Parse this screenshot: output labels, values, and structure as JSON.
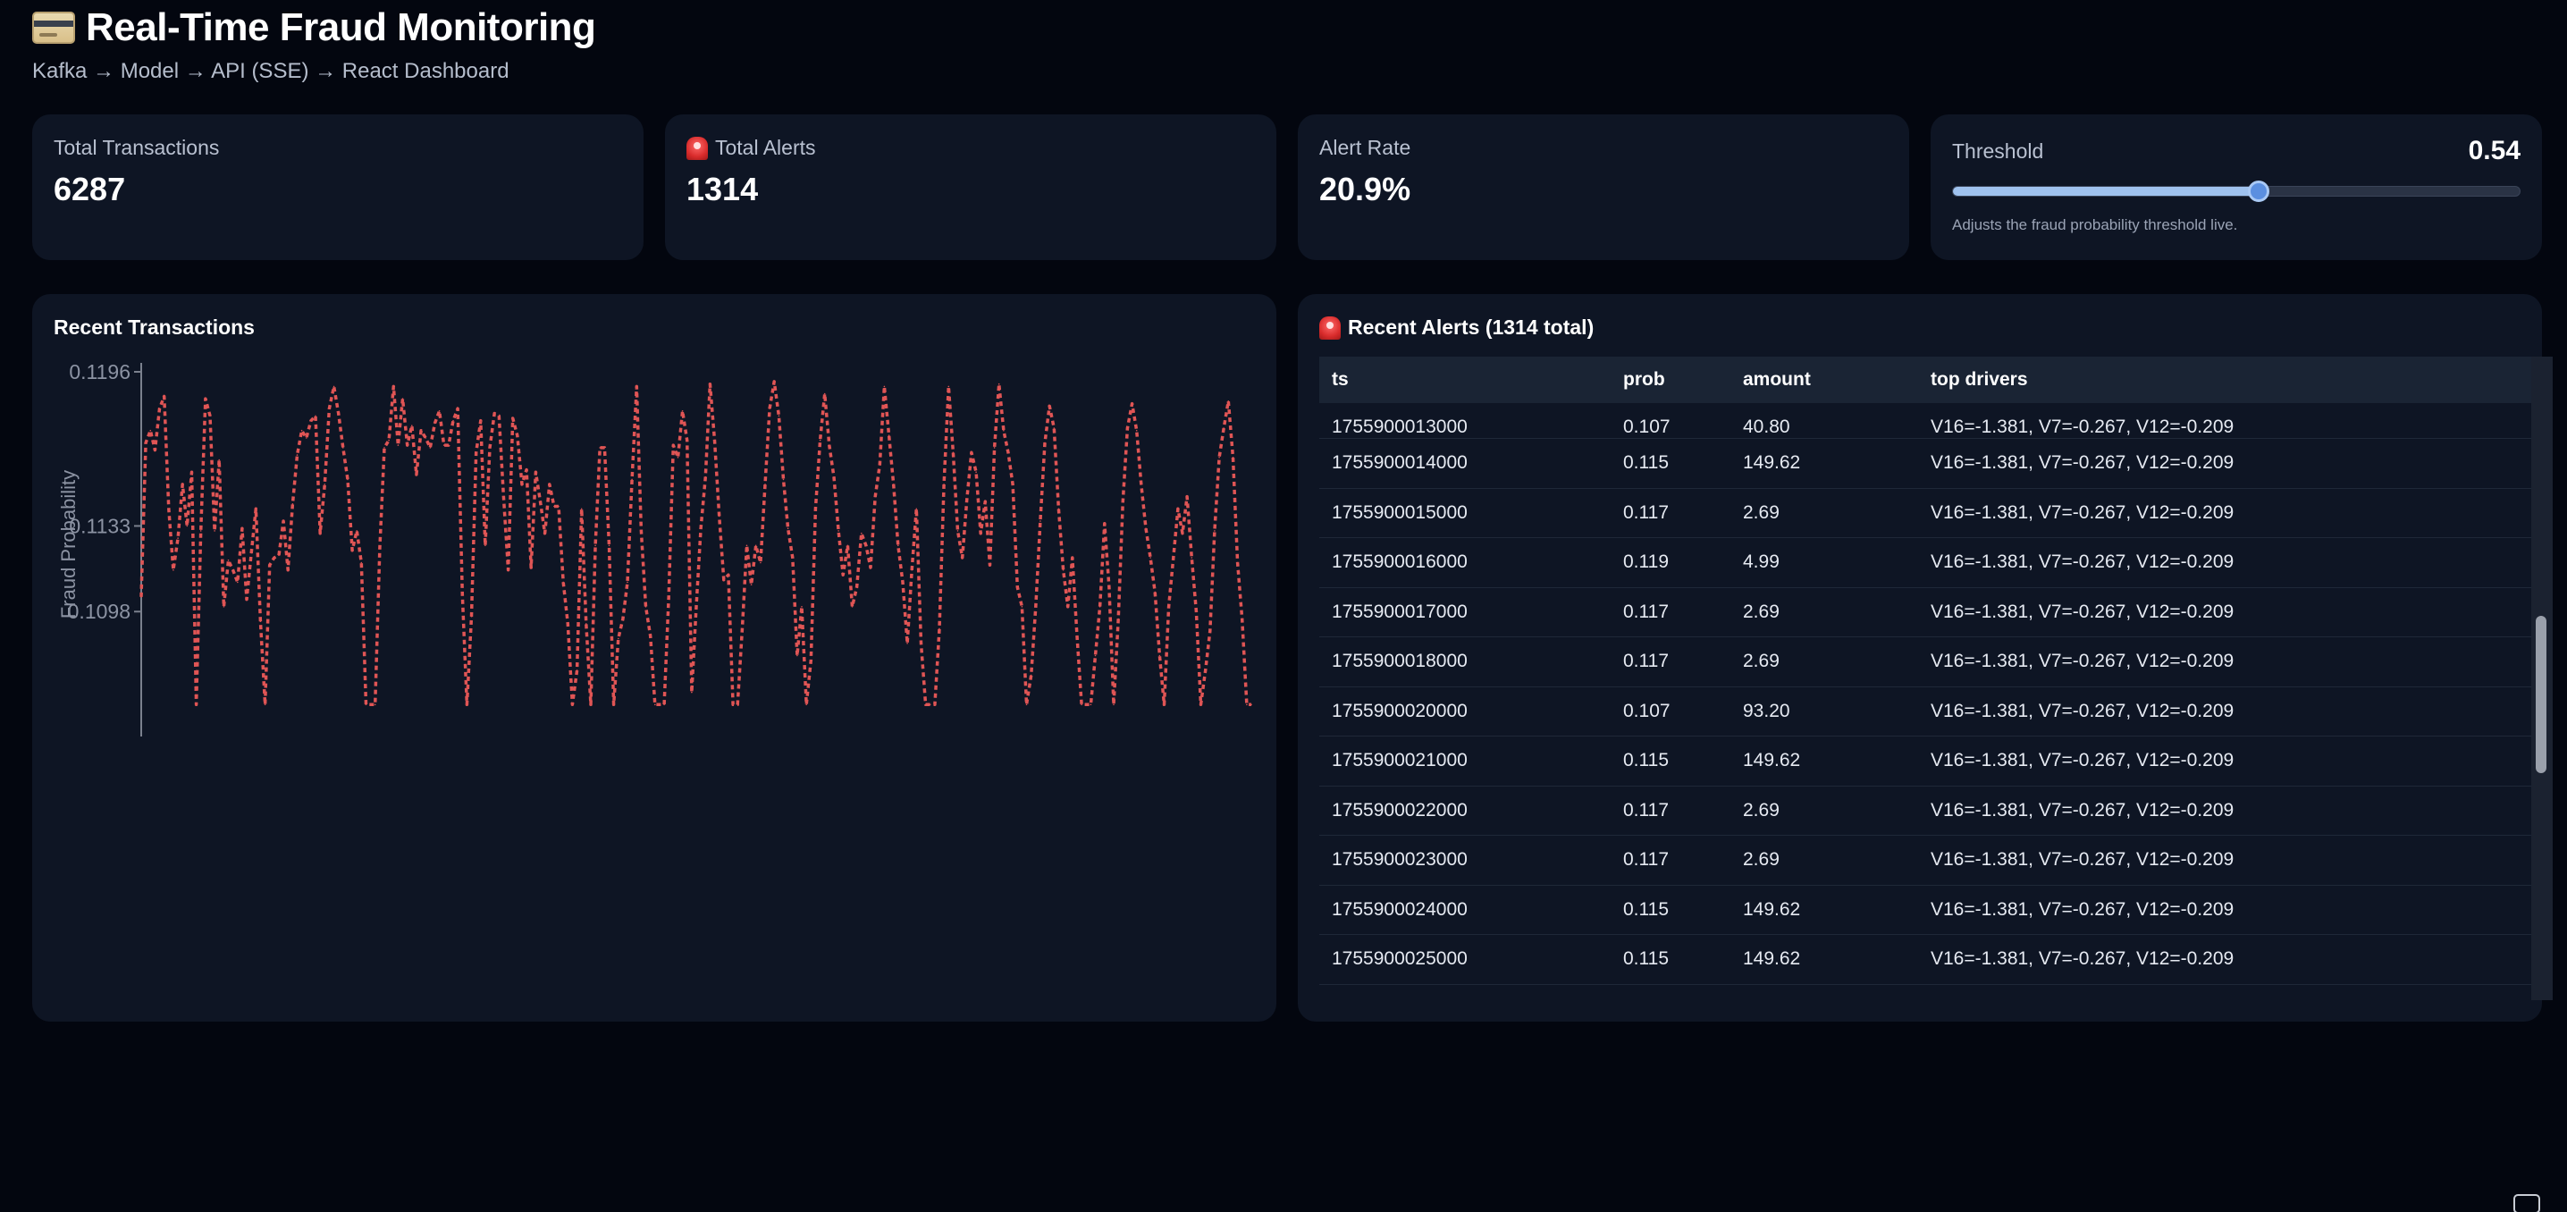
{
  "header": {
    "title": "Real-Time Fraud Monitoring",
    "subtitle": "Kafka → Model → API (SSE) → React Dashboard",
    "title_icon": "credit-card-icon"
  },
  "stats": {
    "total_transactions": {
      "label": "Total Transactions",
      "value": "6287"
    },
    "total_alerts": {
      "label": "Total Alerts",
      "value": "1314",
      "icon": "siren-icon"
    },
    "alert_rate": {
      "label": "Alert Rate",
      "value": "20.9%"
    }
  },
  "threshold": {
    "label": "Threshold",
    "value": "0.54",
    "fraction": 0.54,
    "help": "Adjusts the fraud probability threshold live."
  },
  "transactions_chart": {
    "title": "Recent Transactions",
    "line_color": "#e05555"
  },
  "chart_data": {
    "type": "line",
    "title": "",
    "xlabel": "",
    "ylabel": "Fraud Probability",
    "ylim": [
      0.1059,
      0.1196
    ],
    "y_ticks": [
      "0.1196",
      "0.1133",
      "0.1098"
    ],
    "grid": false,
    "series": [
      {
        "values": [
          0.1104,
          0.1167,
          0.1172,
          0.1164,
          0.1181,
          0.1186,
          0.114,
          0.1115,
          0.1128,
          0.115,
          0.1133,
          0.1155,
          0.106,
          0.1131,
          0.1185,
          0.1178,
          0.1131,
          0.116,
          0.11,
          0.1119,
          0.1115,
          0.111,
          0.1132,
          0.1103,
          0.1122,
          0.114,
          0.1094,
          0.106,
          0.1117,
          0.112,
          0.1121,
          0.1135,
          0.1115,
          0.1142,
          0.1162,
          0.1172,
          0.1169,
          0.1176,
          0.1178,
          0.113,
          0.115,
          0.1181,
          0.119,
          0.1179,
          0.1165,
          0.1152,
          0.1123,
          0.1131,
          0.1118,
          0.106,
          0.106,
          0.106,
          0.1124,
          0.1165,
          0.1168,
          0.119,
          0.1166,
          0.1185,
          0.1166,
          0.1174,
          0.1154,
          0.1172,
          0.1169,
          0.1165,
          0.1175,
          0.118,
          0.1166,
          0.1166,
          0.1176,
          0.1181,
          0.1105,
          0.106,
          0.1096,
          0.1163,
          0.1176,
          0.1125,
          0.1165,
          0.1179,
          0.1178,
          0.1145,
          0.1115,
          0.1177,
          0.117,
          0.115,
          0.1156,
          0.1116,
          0.1155,
          0.1143,
          0.113,
          0.115,
          0.1141,
          0.1141,
          0.111,
          0.1093,
          0.106,
          0.1074,
          0.114,
          0.1093,
          0.106,
          0.1125,
          0.1165,
          0.1165,
          0.1125,
          0.106,
          0.1087,
          0.1095,
          0.111,
          0.1152,
          0.119,
          0.1131,
          0.11,
          0.1088,
          0.106,
          0.106,
          0.106,
          0.1104,
          0.1166,
          0.1161,
          0.118,
          0.1168,
          0.1065,
          0.11,
          0.1132,
          0.1153,
          0.1191,
          0.1168,
          0.1137,
          0.1111,
          0.1113,
          0.106,
          0.106,
          0.109,
          0.1125,
          0.1109,
          0.1125,
          0.1118,
          0.115,
          0.1181,
          0.1192,
          0.1178,
          0.1152,
          0.1132,
          0.112,
          0.108,
          0.11,
          0.106,
          0.1078,
          0.114,
          0.1168,
          0.1187,
          0.1166,
          0.1153,
          0.1131,
          0.1113,
          0.1125,
          0.11,
          0.1108,
          0.113,
          0.1125,
          0.1116,
          0.1145,
          0.1158,
          0.119,
          0.117,
          0.115,
          0.1125,
          0.111,
          0.1085,
          0.1115,
          0.114,
          0.1085,
          0.106,
          0.106,
          0.106,
          0.1091,
          0.115,
          0.119,
          0.1163,
          0.1131,
          0.112,
          0.1144,
          0.1163,
          0.1155,
          0.113,
          0.1143,
          0.1117,
          0.1165,
          0.1191,
          0.1172,
          0.1163,
          0.115,
          0.1108,
          0.11,
          0.106,
          0.1072,
          0.11,
          0.1135,
          0.1167,
          0.1182,
          0.1173,
          0.114,
          0.1115,
          0.11,
          0.112,
          0.1088,
          0.106,
          0.106,
          0.106,
          0.108,
          0.11,
          0.1134,
          0.1108,
          0.106,
          0.1095,
          0.1143,
          0.1173,
          0.1183,
          0.1172,
          0.115,
          0.1132,
          0.112,
          0.1106,
          0.108,
          0.106,
          0.11,
          0.112,
          0.114,
          0.113,
          0.1145,
          0.112,
          0.1098,
          0.106,
          0.1074,
          0.109,
          0.1131,
          0.1161,
          0.1173,
          0.1184,
          0.1161,
          0.1118,
          0.1095,
          0.106,
          0.106
        ]
      }
    ]
  },
  "alerts_table": {
    "title": "Recent Alerts (1314 total)",
    "icon": "siren-icon",
    "columns": [
      "ts",
      "prob",
      "amount",
      "top drivers"
    ],
    "rows": [
      [
        "1755900013000",
        "0.107",
        "40.80",
        "V16=-1.381, V7=-0.267, V12=-0.209"
      ],
      [
        "1755900014000",
        "0.115",
        "149.62",
        "V16=-1.381, V7=-0.267, V12=-0.209"
      ],
      [
        "1755900015000",
        "0.117",
        "2.69",
        "V16=-1.381, V7=-0.267, V12=-0.209"
      ],
      [
        "1755900016000",
        "0.119",
        "4.99",
        "V16=-1.381, V7=-0.267, V12=-0.209"
      ],
      [
        "1755900017000",
        "0.117",
        "2.69",
        "V16=-1.381, V7=-0.267, V12=-0.209"
      ],
      [
        "1755900018000",
        "0.117",
        "2.69",
        "V16=-1.381, V7=-0.267, V12=-0.209"
      ],
      [
        "1755900020000",
        "0.107",
        "93.20",
        "V16=-1.381, V7=-0.267, V12=-0.209"
      ],
      [
        "1755900021000",
        "0.115",
        "149.62",
        "V16=-1.381, V7=-0.267, V12=-0.209"
      ],
      [
        "1755900022000",
        "0.117",
        "2.69",
        "V16=-1.381, V7=-0.267, V12=-0.209"
      ],
      [
        "1755900023000",
        "0.117",
        "2.69",
        "V16=-1.381, V7=-0.267, V12=-0.209"
      ],
      [
        "1755900024000",
        "0.115",
        "149.62",
        "V16=-1.381, V7=-0.267, V12=-0.209"
      ],
      [
        "1755900025000",
        "0.115",
        "149.62",
        "V16=-1.381, V7=-0.267, V12=-0.209"
      ]
    ]
  },
  "colors": {
    "background": "#03060f",
    "panel": "#0e1524",
    "accent": "#9fc2ef",
    "alert_line": "#e05555"
  },
  "corner_icon": "screenshot-icon"
}
